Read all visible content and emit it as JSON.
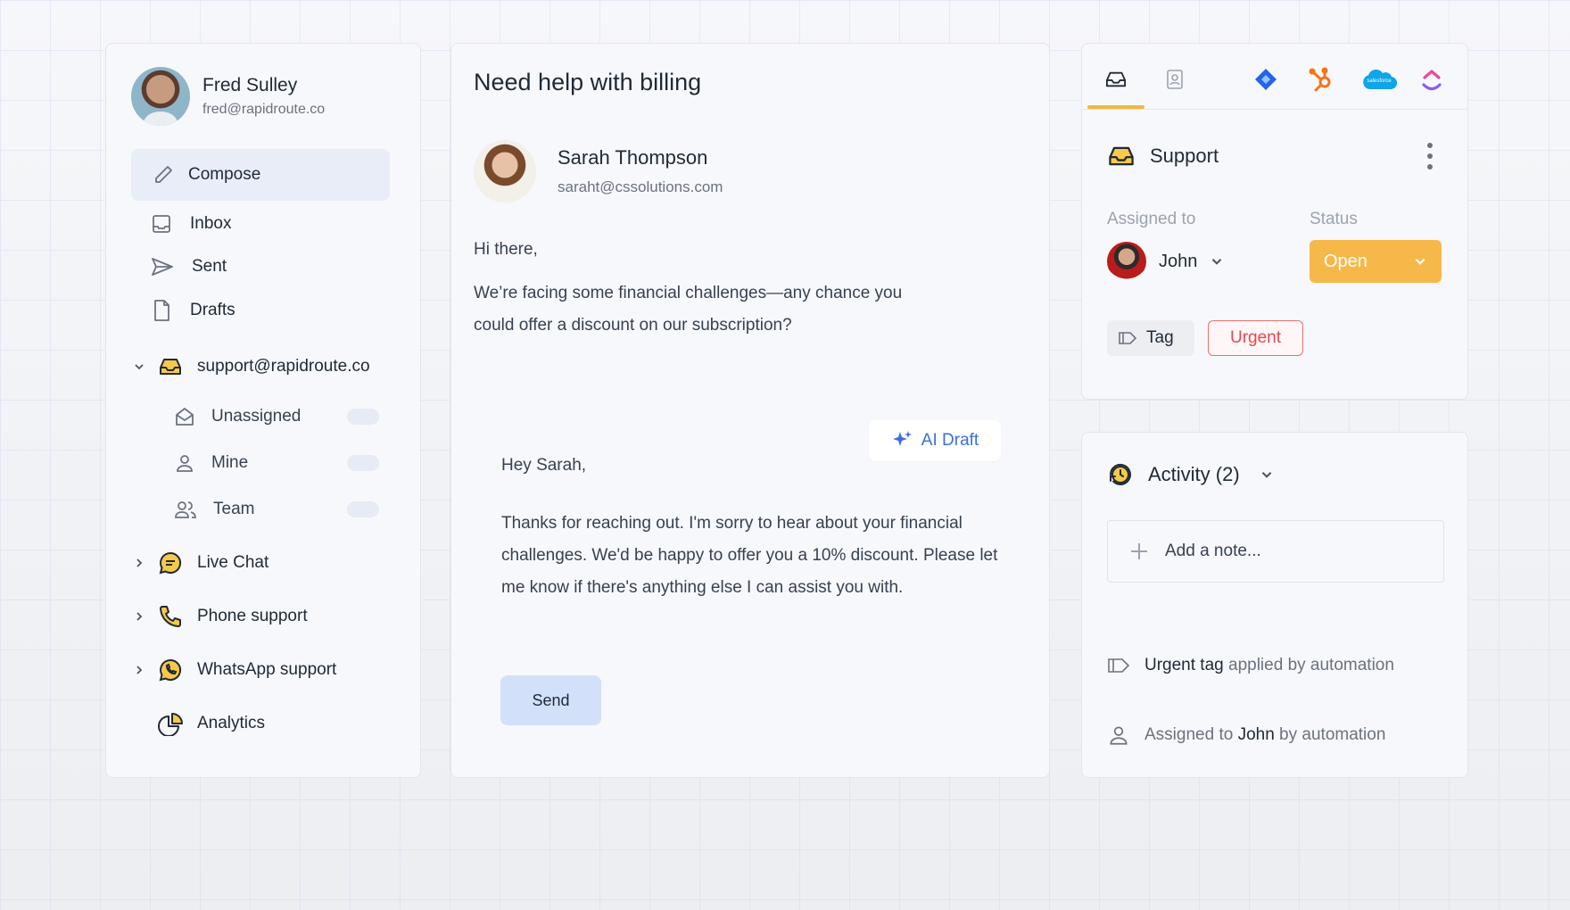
{
  "sidebar": {
    "user": {
      "name": "Fred Sulley",
      "email": "fred@rapidroute.co"
    },
    "compose_label": "Compose",
    "nav": [
      {
        "label": "Inbox",
        "icon": "inbox-icon"
      },
      {
        "label": "Sent",
        "icon": "send-icon"
      },
      {
        "label": "Drafts",
        "icon": "file-icon"
      }
    ],
    "mailbox": {
      "label": "support@rapidroute.co",
      "items": [
        {
          "label": "Unassigned",
          "icon": "envelope-open-icon"
        },
        {
          "label": "Mine",
          "icon": "user-icon"
        },
        {
          "label": "Team",
          "icon": "users-icon"
        }
      ]
    },
    "channels": [
      {
        "label": "Live Chat",
        "icon": "chat-icon"
      },
      {
        "label": "Phone support",
        "icon": "phone-icon"
      },
      {
        "label": "WhatsApp support",
        "icon": "whatsapp-icon"
      }
    ],
    "analytics_label": "Analytics"
  },
  "message": {
    "subject": "Need help with billing",
    "sender": {
      "name": "Sarah Thompson",
      "email": "saraht@cssolutions.com"
    },
    "greeting": "Hi there,",
    "body": "We’re facing some financial challenges—any chance you could offer a discount on our subscription?",
    "ai_draft_label": "AI Draft",
    "reply": {
      "greeting": "Hey Sarah,",
      "body": "Thanks for reaching out. I'm sorry to hear about your financial challenges. We'd be happy to offer you a 10% discount. Please let me know if there's anything else I can assist you with."
    },
    "send_label": "Send"
  },
  "details": {
    "tabs": [
      "inbox-icon",
      "contact-card-icon",
      "jira-icon",
      "hubspot-icon",
      "salesforce-icon",
      "clickup-icon"
    ],
    "salesforce_text": "salesforce",
    "inbox_name": "Support",
    "assigned_label": "Assigned to",
    "assignee": "John",
    "status_label": "Status",
    "status_value": "Open",
    "tag_label": "Tag",
    "urgent_label": "Urgent",
    "colors": {
      "accent": "#f7b84a",
      "urgent": "#e5484d",
      "link": "#3b6fd8"
    }
  },
  "activity": {
    "title": "Activity (2)",
    "note_placeholder": "Add a note...",
    "log": [
      {
        "strong": "Urgent tag",
        "rest": " applied by automation"
      },
      {
        "pre": "Assigned to ",
        "strong": "John",
        "rest": " by automation"
      }
    ]
  }
}
